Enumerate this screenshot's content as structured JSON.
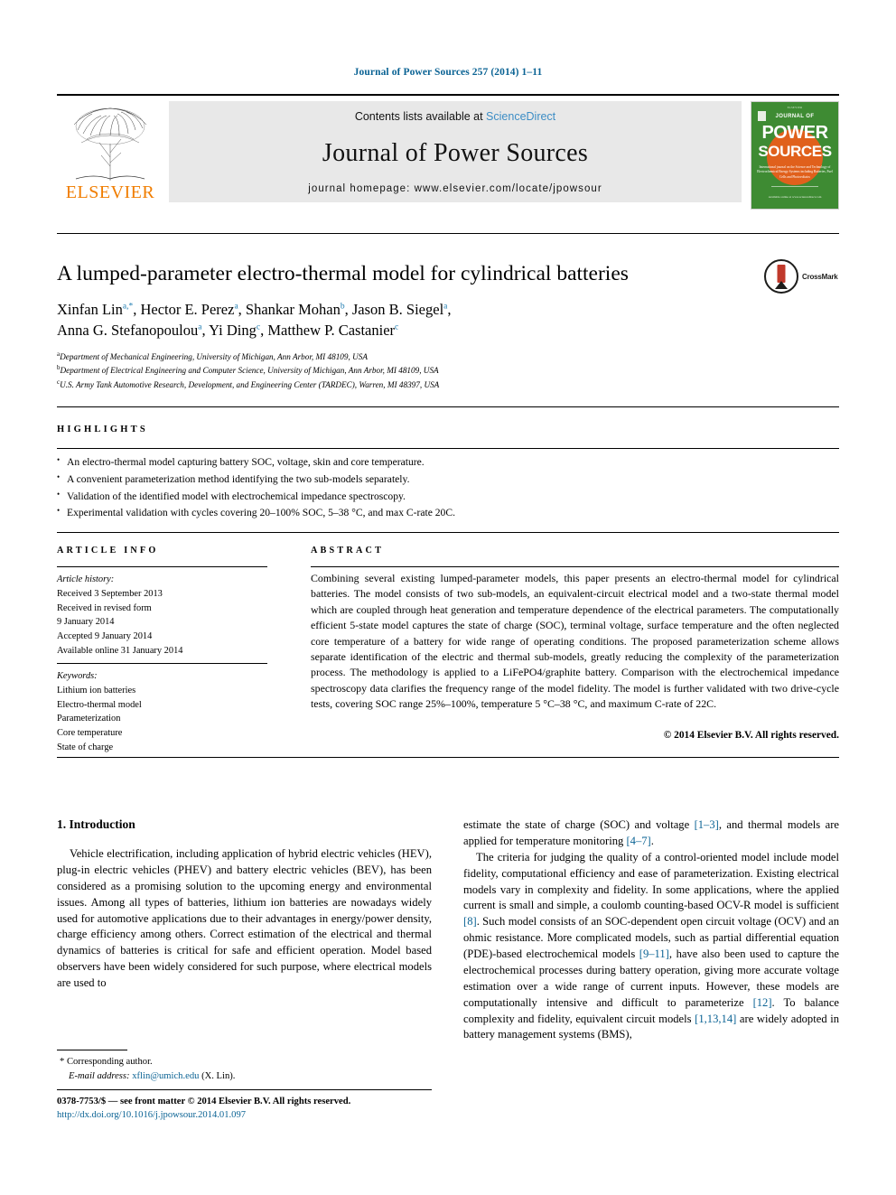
{
  "running_head": "Journal of Power Sources 257 (2014) 1–11",
  "masthead": {
    "publisher_name": "ELSEVIER",
    "contents_prefix": "Contents lists available at ",
    "sciencedirect": "ScienceDirect",
    "journal_name": "Journal of Power Sources",
    "homepage": "journal homepage: www.elsevier.com/locate/jpowsour",
    "cover": {
      "top_label": "ELSEVIER",
      "line1": "JOURNAL OF",
      "line2": "POWER",
      "line3": "SOURCES",
      "subtitle": "International journal on the Science and Technology of Electrochemical Energy Systems including Batteries, Fuel Cells and Photovoltaics",
      "footer": "Available online at www.sciencedirect.com"
    }
  },
  "article": {
    "title": "A lumped-parameter electro-thermal model for cylindrical batteries",
    "crossmark_label": "CrossMark",
    "authors_line_1": "Xinfan Lin",
    "authors": [
      {
        "name": "Xinfan Lin",
        "marks": "a,*"
      },
      {
        "name": "Hector E. Perez",
        "marks": "a"
      },
      {
        "name": "Shankar Mohan",
        "marks": "b"
      },
      {
        "name": "Jason B. Siegel",
        "marks": "a"
      },
      {
        "name": "Anna G. Stefanopoulou",
        "marks": "a"
      },
      {
        "name": "Yi Ding",
        "marks": "c"
      },
      {
        "name": "Matthew P. Castanier",
        "marks": "c"
      }
    ],
    "affiliations": [
      {
        "mark": "a",
        "text": "Department of Mechanical Engineering, University of Michigan, Ann Arbor, MI 48109, USA"
      },
      {
        "mark": "b",
        "text": "Department of Electrical Engineering and Computer Science, University of Michigan, Ann Arbor, MI 48109, USA"
      },
      {
        "mark": "c",
        "text": "U.S. Army Tank Automotive Research, Development, and Engineering Center (TARDEC), Warren, MI 48397, USA"
      }
    ]
  },
  "highlights": {
    "heading": "HIGHLIGHTS",
    "items": [
      "An electro-thermal model capturing battery SOC, voltage, skin and core temperature.",
      "A convenient parameterization method identifying the two sub-models separately.",
      "Validation of the identified model with electrochemical impedance spectroscopy.",
      "Experimental validation with cycles covering 20–100% SOC, 5–38 °C, and max C-rate 20C."
    ]
  },
  "article_info": {
    "heading": "ARTICLE INFO",
    "history_label": "Article history:",
    "history": [
      "Received 3 September 2013",
      "Received in revised form",
      "9 January 2014",
      "Accepted 9 January 2014",
      "Available online 31 January 2014"
    ],
    "keywords_label": "Keywords:",
    "keywords": [
      "Lithium ion batteries",
      "Electro-thermal model",
      "Parameterization",
      "Core temperature",
      "State of charge"
    ]
  },
  "abstract": {
    "heading": "ABSTRACT",
    "text": "Combining several existing lumped-parameter models, this paper presents an electro-thermal model for cylindrical batteries. The model consists of two sub-models, an equivalent-circuit electrical model and a two-state thermal model which are coupled through heat generation and temperature dependence of the electrical parameters. The computationally efficient 5-state model captures the state of charge (SOC), terminal voltage, surface temperature and the often neglected core temperature of a battery for wide range of operating conditions. The proposed parameterization scheme allows separate identification of the electric and thermal sub-models, greatly reducing the complexity of the parameterization process. The methodology is applied to a LiFePO4/graphite battery. Comparison with the electrochemical impedance spectroscopy data clarifies the frequency range of the model fidelity. The model is further validated with two drive-cycle tests, covering SOC range 25%–100%, temperature 5 °C–38 °C, and maximum C-rate of 22C.",
    "copyright": "© 2014 Elsevier B.V. All rights reserved."
  },
  "body": {
    "section_number_title": "1. Introduction",
    "left_paragraph": "Vehicle electrification, including application of hybrid electric vehicles (HEV), plug-in electric vehicles (PHEV) and battery electric vehicles (BEV), has been considered as a promising solution to the upcoming energy and environmental issues. Among all types of batteries, lithium ion batteries are nowadays widely used for automotive applications due to their advantages in energy/power density, charge efficiency among others. Correct estimation of the electrical and thermal dynamics of batteries is critical for safe and efficient operation. Model based observers have been widely considered for such purpose, where electrical models are used to",
    "right_paragraph_1_a": "estimate the state of charge (SOC) and voltage ",
    "right_paragraph_1_ref1": "[1–3]",
    "right_paragraph_1_b": ", and thermal models are applied for temperature monitoring ",
    "right_paragraph_1_ref2": "[4–7]",
    "right_paragraph_1_c": ".",
    "right_paragraph_2_a": "The criteria for judging the quality of a control-oriented model include model fidelity, computational efficiency and ease of parameterization. Existing electrical models vary in complexity and fidelity. In some applications, where the applied current is small and simple, a coulomb counting-based OCV-R model is sufficient ",
    "right_paragraph_2_ref1": "[8]",
    "right_paragraph_2_b": ". Such model consists of an SOC-dependent open circuit voltage (OCV) and an ohmic resistance. More complicated models, such as partial differential equation (PDE)-based electrochemical models ",
    "right_paragraph_2_ref2": "[9–11]",
    "right_paragraph_2_c": ", have also been used to capture the electrochemical processes during battery operation, giving more accurate voltage estimation over a wide range of current inputs. However, these models are computationally intensive and difficult to parameterize ",
    "right_paragraph_2_ref3": "[12]",
    "right_paragraph_2_d": ". To balance complexity and fidelity, equivalent circuit models ",
    "right_paragraph_2_ref4": "[1,13,14]",
    "right_paragraph_2_e": " are widely adopted in battery management systems (BMS),"
  },
  "footnote": {
    "corresponding": "* Corresponding author.",
    "email_label": "E-mail address:",
    "email": "xflin@umich.edu",
    "email_suffix": "(X. Lin)."
  },
  "footer": {
    "issn_line": "0378-7753/$ — see front matter © 2014 Elsevier B.V. All rights reserved.",
    "doi": "http://dx.doi.org/10.1016/j.jpowsour.2014.01.097"
  },
  "colors": {
    "link_blue": "#0b6394",
    "sciencedirect_blue": "#3c8dc5",
    "elsevier_orange": "#f07d00",
    "cover_green": "#3e8b33",
    "cover_orange": "#e0601c"
  }
}
